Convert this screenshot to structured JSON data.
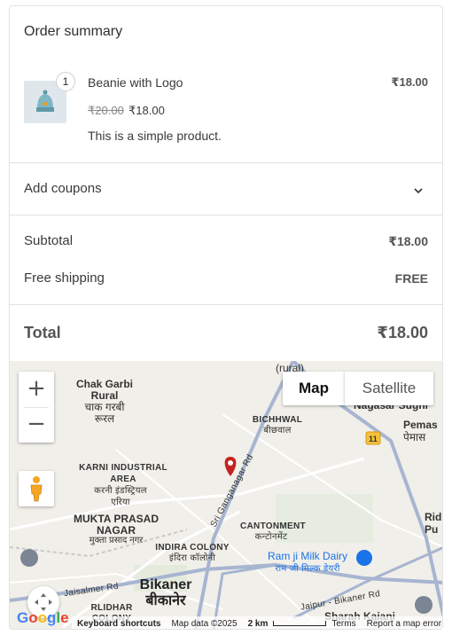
{
  "summary": {
    "title": "Order summary"
  },
  "product": {
    "quantity": "1",
    "name": "Beanie with Logo",
    "price": "₹18.00",
    "old_price": "₹20.00",
    "new_price": "₹18.00",
    "description": "This is a simple product."
  },
  "coupons": {
    "label": "Add coupons"
  },
  "totals": {
    "subtotal_label": "Subtotal",
    "subtotal_value": "₹18.00",
    "shipping_label": "Free shipping",
    "shipping_value": "FREE",
    "total_label": "Total",
    "total_value": "₹18.00"
  },
  "map": {
    "zoom_in": "+",
    "zoom_out": "−",
    "type_map": "Map",
    "type_satellite": "Satellite",
    "labels": {
      "chak_garbi": "Chak Garbi Rural",
      "chak_garbi_hi": "चाक गरबी रूरल",
      "karni": "KARNI INDUSTRIAL AREA",
      "karni_hi": "करनी इंडस्ट्रियल एरिया",
      "bichhwal": "BICHHWAL",
      "bichhwal_hi": "बीछवाल",
      "mukta": "MUKTA PRASAD NAGAR",
      "mukta_hi": "मुक्ता प्रसाद नगर",
      "indira": "INDIRA COLONY",
      "indira_hi": "इंदिरा कॉलोनी",
      "cantonment": "CANTONMENT",
      "cantonment_hi": "कन्टोनमेंट",
      "ramji": "Ram ji Milk Dairy",
      "ramji_hi": "राम जी मिल्क डेयरी",
      "bikaner": "Bikaner",
      "bikaner_hi": "बीकानेर",
      "nagasar": "Nagasar Sugni",
      "pemas": "Pemas",
      "pemas_hi": "पेमास",
      "rural_top": "(rural)",
      "road_sri_ganganagar": "Sri Ganganagar Rd",
      "road_jaisalmer": "Jaisalmer Rd",
      "road_jaipur": "Jaipur - Bikaner Rd",
      "highway_11": "11",
      "rid": "Rid",
      "pu": "Pu",
      "rlidhar": "RLIDHAR",
      "colony": "COLONY",
      "sharah": "Sharah Kaiani"
    },
    "attribution": {
      "keyboard": "Keyboard shortcuts",
      "map_data": "Map data ©2025",
      "scale": "2 km",
      "terms": "Terms",
      "report": "Report a map error"
    },
    "google_logo": "Google"
  }
}
